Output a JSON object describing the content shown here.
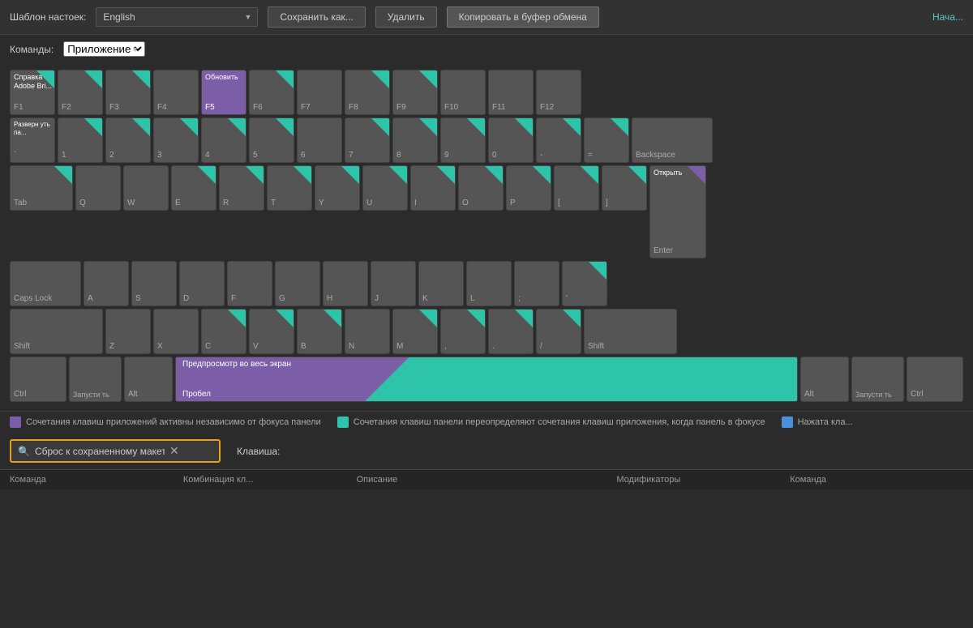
{
  "topBar": {
    "templateLabel": "Шаблон настоек:",
    "templateValue": "English",
    "saveAsLabel": "Сохранить как...",
    "deleteLabel": "Удалить",
    "copyLabel": "Копировать в буфер обмена",
    "startLabel": "Нача..."
  },
  "commandsBar": {
    "label": "Команды:",
    "value": "Приложение"
  },
  "keys": {
    "f1": {
      "label": "F1",
      "cmd": "Справка Adobe Bri..."
    },
    "f2": {
      "label": "F2",
      "cmd": ""
    },
    "f3": {
      "label": "F3",
      "cmd": ""
    },
    "f4": {
      "label": "F4",
      "cmd": ""
    },
    "f5": {
      "label": "F5",
      "cmd": "Обновить",
      "purple": true
    },
    "f6": {
      "label": "F6",
      "cmd": ""
    },
    "f7": {
      "label": "F7",
      "cmd": ""
    },
    "f8": {
      "label": "F8",
      "cmd": ""
    },
    "f9": {
      "label": "F9",
      "cmd": ""
    },
    "f10": {
      "label": "F10",
      "cmd": ""
    },
    "f11": {
      "label": "F11",
      "cmd": ""
    },
    "f12": {
      "label": "F12",
      "cmd": ""
    },
    "tilde": {
      "label": "`",
      "cmd": "Разверн уть па..."
    },
    "n1": {
      "label": "1",
      "cmd": ""
    },
    "n2": {
      "label": "2",
      "cmd": ""
    },
    "n3": {
      "label": "3",
      "cmd": ""
    },
    "n4": {
      "label": "4",
      "cmd": ""
    },
    "n5": {
      "label": "5",
      "cmd": ""
    },
    "n6": {
      "label": "6",
      "cmd": ""
    },
    "n7": {
      "label": "7",
      "cmd": ""
    },
    "n8": {
      "label": "8",
      "cmd": ""
    },
    "n9": {
      "label": "9",
      "cmd": ""
    },
    "n0": {
      "label": "0",
      "cmd": ""
    },
    "minus": {
      "label": "-",
      "cmd": ""
    },
    "equals": {
      "label": "=",
      "cmd": ""
    },
    "backspace": {
      "label": "Backspace",
      "cmd": ""
    },
    "tab": {
      "label": "Tab",
      "cmd": ""
    },
    "q": {
      "label": "Q",
      "cmd": ""
    },
    "w": {
      "label": "W",
      "cmd": ""
    },
    "e": {
      "label": "E",
      "cmd": ""
    },
    "r": {
      "label": "R",
      "cmd": ""
    },
    "t": {
      "label": "T",
      "cmd": ""
    },
    "y": {
      "label": "Y",
      "cmd": ""
    },
    "u": {
      "label": "U",
      "cmd": ""
    },
    "i": {
      "label": "I",
      "cmd": ""
    },
    "o": {
      "label": "O",
      "cmd": ""
    },
    "p": {
      "label": "P",
      "cmd": ""
    },
    "lbracket": {
      "label": "[",
      "cmd": ""
    },
    "rbracket": {
      "label": "]",
      "cmd": ""
    },
    "enter": {
      "label": "Enter",
      "cmd": "Открыть",
      "purple": true
    },
    "caps": {
      "label": "Caps Lock",
      "cmd": ""
    },
    "a": {
      "label": "A",
      "cmd": ""
    },
    "s": {
      "label": "S",
      "cmd": ""
    },
    "d": {
      "label": "D",
      "cmd": ""
    },
    "f": {
      "label": "F",
      "cmd": ""
    },
    "g": {
      "label": "G",
      "cmd": ""
    },
    "h": {
      "label": "H",
      "cmd": ""
    },
    "j": {
      "label": "J",
      "cmd": ""
    },
    "k": {
      "label": "K",
      "cmd": ""
    },
    "l": {
      "label": "L",
      "cmd": ""
    },
    "semi": {
      "label": ";",
      "cmd": ""
    },
    "quote": {
      "label": "'",
      "cmd": ""
    },
    "lshift": {
      "label": "Shift",
      "cmd": ""
    },
    "z": {
      "label": "Z",
      "cmd": ""
    },
    "x": {
      "label": "X",
      "cmd": ""
    },
    "c": {
      "label": "C",
      "cmd": ""
    },
    "v": {
      "label": "V",
      "cmd": ""
    },
    "b": {
      "label": "B",
      "cmd": ""
    },
    "n": {
      "label": "N",
      "cmd": ""
    },
    "m": {
      "label": "M",
      "cmd": ""
    },
    "comma": {
      "label": ",",
      "cmd": ""
    },
    "dot": {
      "label": ".",
      "cmd": ""
    },
    "slash": {
      "label": "/",
      "cmd": ""
    },
    "rshift": {
      "label": "Shift",
      "cmd": ""
    },
    "lctrl": {
      "label": "Ctrl",
      "cmd": ""
    },
    "lwin": {
      "label": "Запусти ть",
      "cmd": ""
    },
    "lalt": {
      "label": "Alt",
      "cmd": ""
    },
    "space": {
      "label": "Пробел",
      "cmd": "Предпросмотр во весь экран"
    },
    "ralt": {
      "label": "Alt",
      "cmd": ""
    },
    "rwin": {
      "label": "Запусти ть",
      "cmd": ""
    },
    "rctrl": {
      "label": "Ctrl",
      "cmd": ""
    }
  },
  "legend": {
    "purple": "Сочетания клавиш приложений активны независимо от фокуса панели",
    "teal": "Сочетания клавиш панели переопределяют сочетания клавиш приложения, когда панель в фокусе",
    "blue": "Нажата кла..."
  },
  "search": {
    "placeholder": "Сброс к сохраненному макету",
    "value": "Сброс к сохраненному макету",
    "keyLabel": "Клавиша:"
  },
  "tableHeader": {
    "cmd": "Команда",
    "combo": "Комбинация кл...",
    "desc": "Описание",
    "mod": "Модификаторы",
    "cmd2": "Команда"
  }
}
